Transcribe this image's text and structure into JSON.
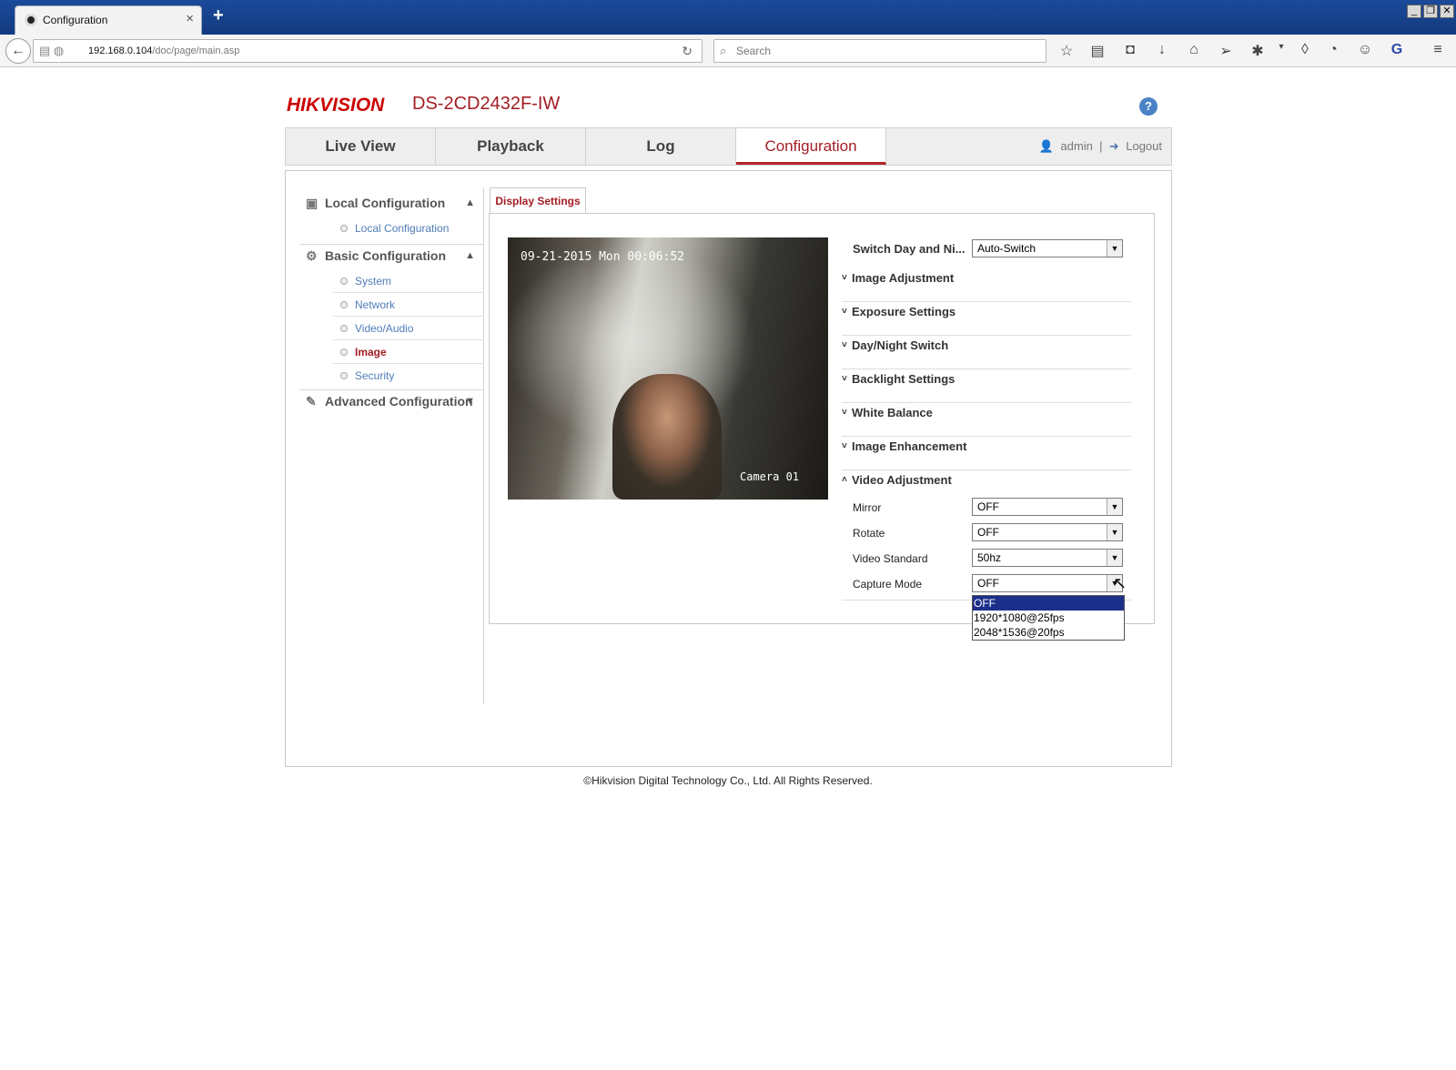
{
  "browser": {
    "tab_title": "Configuration",
    "url_host": "192.168.0.104",
    "url_path": "/doc/page/main.asp",
    "search_placeholder": "Search"
  },
  "header": {
    "brand": "HIKVISION",
    "model": "DS-2CD2432F-IW",
    "help_icon": "?"
  },
  "topnav": {
    "tabs": [
      {
        "label": "Live View"
      },
      {
        "label": "Playback"
      },
      {
        "label": "Log"
      },
      {
        "label": "Configuration",
        "active": true
      }
    ],
    "user": "admin",
    "separator": "|",
    "logout": "Logout"
  },
  "sidebar": {
    "sections": [
      {
        "label": "Local Configuration",
        "items": [
          "Local Configuration"
        ]
      },
      {
        "label": "Basic Configuration",
        "items": [
          "System",
          "Network",
          "Video/Audio",
          "Image",
          "Security"
        ],
        "active_item": "Image"
      },
      {
        "label": "Advanced Configuration",
        "items": []
      }
    ]
  },
  "content": {
    "subtab": "Display Settings",
    "video": {
      "timestamp": "09-21-2015 Mon 00:06:52",
      "camera_label": "Camera 01"
    },
    "switch_day_night": {
      "label": "Switch Day and Ni...",
      "value": "Auto-Switch"
    },
    "accordions": [
      {
        "label": "Image Adjustment",
        "expanded": false
      },
      {
        "label": "Exposure Settings",
        "expanded": false
      },
      {
        "label": "Day/Night Switch",
        "expanded": false
      },
      {
        "label": "Backlight Settings",
        "expanded": false
      },
      {
        "label": "White Balance",
        "expanded": false
      },
      {
        "label": "Image Enhancement",
        "expanded": false
      },
      {
        "label": "Video Adjustment",
        "expanded": true
      }
    ],
    "video_adjustment": {
      "mirror": {
        "label": "Mirror",
        "value": "OFF"
      },
      "rotate": {
        "label": "Rotate",
        "value": "OFF"
      },
      "video_standard": {
        "label": "Video Standard",
        "value": "50hz"
      },
      "capture_mode": {
        "label": "Capture Mode",
        "value": "OFF"
      }
    },
    "capture_mode_options": [
      "OFF",
      "1920*1080@25fps",
      "2048*1536@20fps"
    ]
  },
  "footer": "©Hikvision Digital Technology Co., Ltd. All Rights Reserved.",
  "colors": {
    "accent": "#a31d24",
    "link": "#4f7cb8",
    "selection": "#1c2f8a"
  }
}
